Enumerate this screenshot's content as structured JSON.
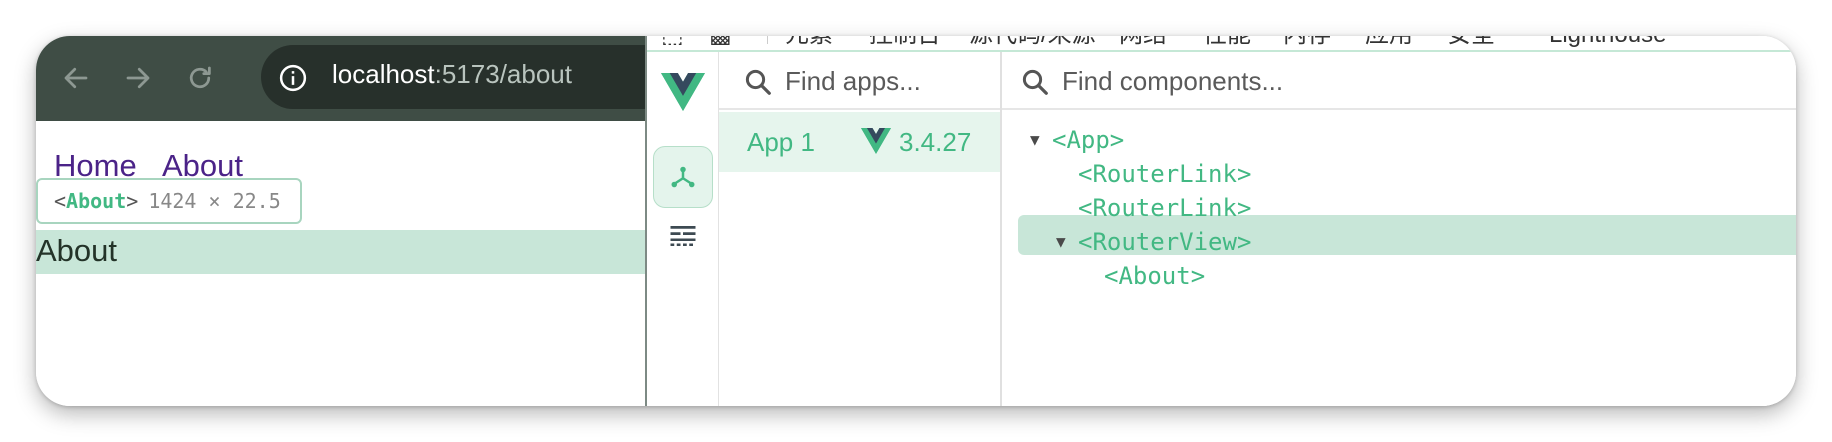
{
  "browser": {
    "url_host": "localhost",
    "url_path": ":5173/about",
    "nav_links": [
      "Home",
      "About"
    ],
    "tooltip": {
      "tag": "About",
      "dimensions": "1424 × 22.5"
    },
    "page_heading": "About"
  },
  "devtools": {
    "tabs": [
      "⬚",
      "元素",
      "控制台",
      "源代码/来源",
      "网络",
      "性能",
      "内存",
      "应用",
      "安全",
      "Lighthouse"
    ],
    "apps_search_placeholder": "Find apps...",
    "components_search_placeholder": "Find components...",
    "app": {
      "name": "App 1",
      "vue_version": "3.4.27"
    },
    "tree": [
      {
        "label": "<App>",
        "expanded": true,
        "depth": 0
      },
      {
        "label": "<RouterLink>",
        "expanded": false,
        "depth": 1
      },
      {
        "label": "<RouterLink>",
        "expanded": false,
        "depth": 1
      },
      {
        "label": "<RouterView>",
        "expanded": true,
        "depth": 1
      },
      {
        "label": "<About>",
        "expanded": false,
        "depth": 2,
        "selected": true
      }
    ]
  },
  "colors": {
    "vue_green": "#42b883",
    "vue_dark": "#35495e",
    "highlight": "#c8e6d8",
    "link": "#4b2388",
    "toolbar": "#3f4d45"
  }
}
